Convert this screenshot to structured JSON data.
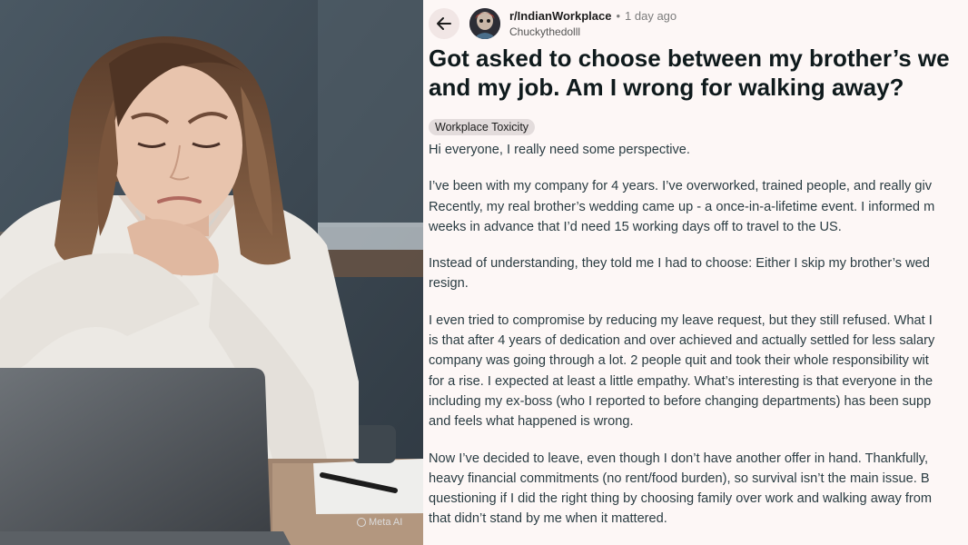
{
  "watermark": {
    "text": "Meta AI"
  },
  "post": {
    "subreddit": "r/IndianWorkplace",
    "separator": "•",
    "time_ago": "1 day ago",
    "username": "Chuckythedolll",
    "title_lines": [
      "Got asked to choose between my brother’s we",
      "and my job. Am I wrong for walking away?"
    ],
    "flair": "Workplace Toxicity",
    "paragraphs": [
      [
        "Hi everyone, I really need some perspective."
      ],
      [
        "I’ve been with my company for 4 years. I’ve overworked, trained people, and really giv",
        "Recently, my real brother’s wedding came up - a once-in-a-lifetime event. I informed m",
        "weeks in advance that I’d need 15 working days off to travel to the US."
      ],
      [
        "Instead of understanding, they told me I had to choose: Either I skip my brother’s wed",
        "resign."
      ],
      [
        "I even tried to compromise by reducing my leave request, but they still refused. What I",
        "is that after 4 years of dedication and over achieved and actually settled for less salary",
        "company was going through a lot. 2 people quit and took their whole responsibility wit",
        "for a rise. I expected at least a little empathy. What’s interesting is that everyone in the",
        "including my ex-boss (who I reported to before changing departments) has been supp",
        "and feels what happened is wrong."
      ],
      [
        "Now I’ve decided to leave, even though I don’t have another offer in hand. Thankfully,",
        "heavy financial commitments (no rent/food burden), so survival isn’t the main issue. B",
        "questioning if I did the right thing by choosing family over work and walking away from",
        "that didn’t stand by me when it mattered."
      ]
    ]
  },
  "icons": {
    "back": "back-arrow-icon",
    "avatar": "user-avatar",
    "watermark": "meta-ai-ring-icon"
  },
  "colors": {
    "panel_bg": "#fdf7f6",
    "flair_bg": "#e3dcdc",
    "title": "#0f1a1c",
    "body": "#2a3c42"
  }
}
